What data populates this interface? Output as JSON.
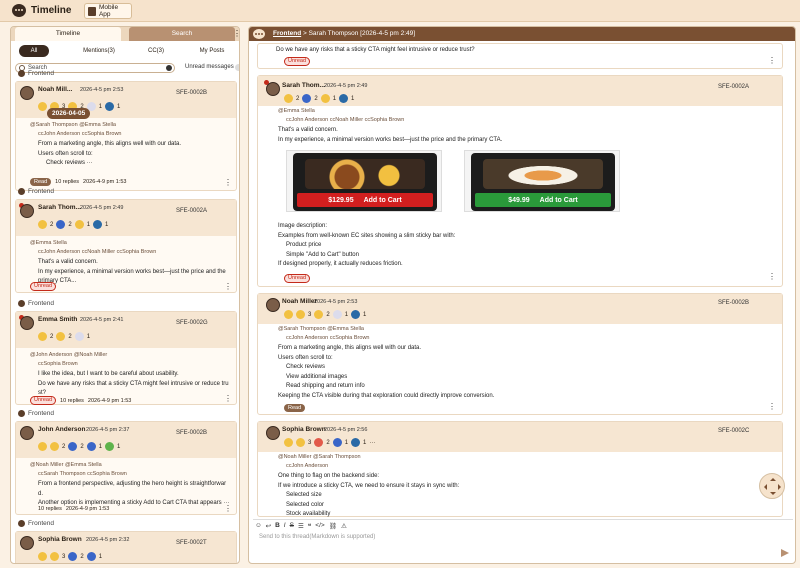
{
  "app": {
    "title": "Timeline",
    "tab_label": "Mobile App"
  },
  "left": {
    "tabs": [
      "Timeline",
      "Search"
    ],
    "filters": [
      "All",
      "Mentions(3)",
      "CC(3)",
      "My Posts"
    ],
    "search_placeholder": "Search",
    "unread_label": "Unread messages",
    "date_pill": "2026-04-05",
    "cards": [
      {
        "topic": "Frontend",
        "author": "Noah Mill...",
        "time": "2026-4-5 pm 2:53",
        "sfe": "SFE-0002B",
        "reactions": [
          "3",
          "2",
          "1",
          "1"
        ],
        "mention": "@Sarah Thompson",
        "mention2": "@Emma Stella",
        "cc": "ccJohn Anderson",
        "cc2": "ccSophia Brown",
        "lines": [
          "From a marketing angle, this aligns well with our data.",
          "Users often scroll to:",
          "Check reviews ···"
        ],
        "status": "Read",
        "replies": "10 replies",
        "reply_time": "2026-4-9 pm 1:53"
      },
      {
        "topic": "Frontend",
        "author": "Sarah Thom...",
        "time": "2026-4-5 pm 2:49",
        "sfe": "SFE-0002A",
        "reactions": [
          "2",
          "2",
          "1",
          "1"
        ],
        "mention": "@Emma Stella",
        "cc": "ccJohn Anderson",
        "cc2": "ccNoah Miller",
        "cc3": "ccSophia Brown",
        "lines": [
          "That's a valid concern.",
          "In my experience, a minimal version works best—just the price and the",
          "primary CTA..."
        ],
        "status": "Unread"
      },
      {
        "topic": "Frontend",
        "author": "Emma Smith",
        "time": "2026-4-5 pm 2:41",
        "sfe": "SFE-0002G",
        "reactions": [
          "2",
          "2",
          "1"
        ],
        "mention": "@John Anderson",
        "mention2": "@Noah Miller",
        "cc": "ccSophia Brown",
        "lines": [
          "I like the idea, but I want to be careful about usability.",
          "Do we have any risks that a sticky CTA might feel intrusive or reduce tru",
          "st?"
        ],
        "status": "Unread",
        "replies": "10 replies",
        "reply_time": "2026-4-9 pm 1:53"
      },
      {
        "topic": "Frontend",
        "author": "John Anderson",
        "time": "2026-4-5 pm 2:37",
        "sfe": "SFE-0002B",
        "reactions": [
          "2",
          "2",
          "1",
          "1"
        ],
        "mention": "@Noah Miller",
        "mention2": "@Emma Stella",
        "cc": "ccSarah Thompson",
        "cc2": "ccSophia Brown",
        "lines": [
          "From a frontend perspective, adjusting the hero height is straightforwar",
          "d.",
          "Another option is implementing a sticky Add to Cart CTA that appears ···"
        ],
        "replies": "10 replies",
        "reply_time": "2026-4-9 pm 1:53"
      },
      {
        "topic": "Frontend",
        "author": "Sophia Brown",
        "time": "2026-4-5 pm 2:32",
        "sfe": "SFE-0002T",
        "reactions": [
          "3",
          "2",
          "1"
        ]
      }
    ]
  },
  "thread": {
    "breadcrumb_topic": "Frontend",
    "breadcrumb_rest": "Sarah Thompson [2026-4-5 pm 2:49]",
    "first_line": "Do we have any risks that a sticky CTA might feel intrusive or reduce trust?",
    "first_status": "Unread",
    "posts": [
      {
        "author": "Sarah Thom...",
        "time": "2026-4-5 pm 2:49",
        "sfe": "SFE-0002A",
        "reactions": [
          "2",
          "2",
          "1",
          "1"
        ],
        "mention": "@Emma Stella",
        "cc": "ccJohn Anderson",
        "cc2": "ccNoah Miller",
        "cc3": "ccSophia Brown",
        "lines": [
          "That's a valid concern.",
          "In my experience, a minimal version works best—just the price and the primary CTA."
        ],
        "price1": "$129.95",
        "price2": "$49.99",
        "cta": "Add to Cart",
        "lines2": [
          "Image description:",
          "Examples from well-known EC sites showing a slim sticky bar with:"
        ],
        "bullets": [
          "Product price",
          "Simple \"Add to Cart\" button"
        ],
        "lines3": [
          "If designed properly, it actually reduces friction."
        ],
        "status": "Unread"
      },
      {
        "author": "Noah Miller",
        "time": "2026-4-5 pm 2:53",
        "sfe": "SFE-0002B",
        "reactions": [
          "3",
          "2",
          "1",
          "1"
        ],
        "mention": "@Sarah Thompson",
        "mention2": "@Emma Stella",
        "cc": "ccJohn Anderson",
        "cc2": "ccSophia Brown",
        "lines": [
          "From a marketing angle, this aligns well with our data.",
          "Users often scroll to:"
        ],
        "bullets": [
          "Check reviews",
          "View additional images",
          "Read shipping and return info"
        ],
        "lines3": [
          "Keeping the CTA visible during that exploration could directly improve conversion."
        ],
        "status": "Read"
      },
      {
        "author": "Sophia Brown",
        "time": "2026-4-5 pm 2:56",
        "sfe": "SFE-0002C",
        "reactions": [
          "3",
          "2",
          "1",
          "1"
        ],
        "mention": "@Noah Miller",
        "mention2": "@Sarah Thompson",
        "cc": "ccJohn Anderson",
        "lines": [
          "One thing to flag on the backend side:",
          "If we introduce a sticky CTA, we need to ensure it stays in sync with:"
        ],
        "bullets": [
          "Selected size",
          "Selected color",
          "Stock availability"
        ]
      }
    ],
    "composer_placeholder": "Send to this thread(Markdown is supported)"
  },
  "colors": {
    "brand": "#7a5032",
    "unread": "#c42a1a",
    "header_bg": "#f6e6d2"
  }
}
